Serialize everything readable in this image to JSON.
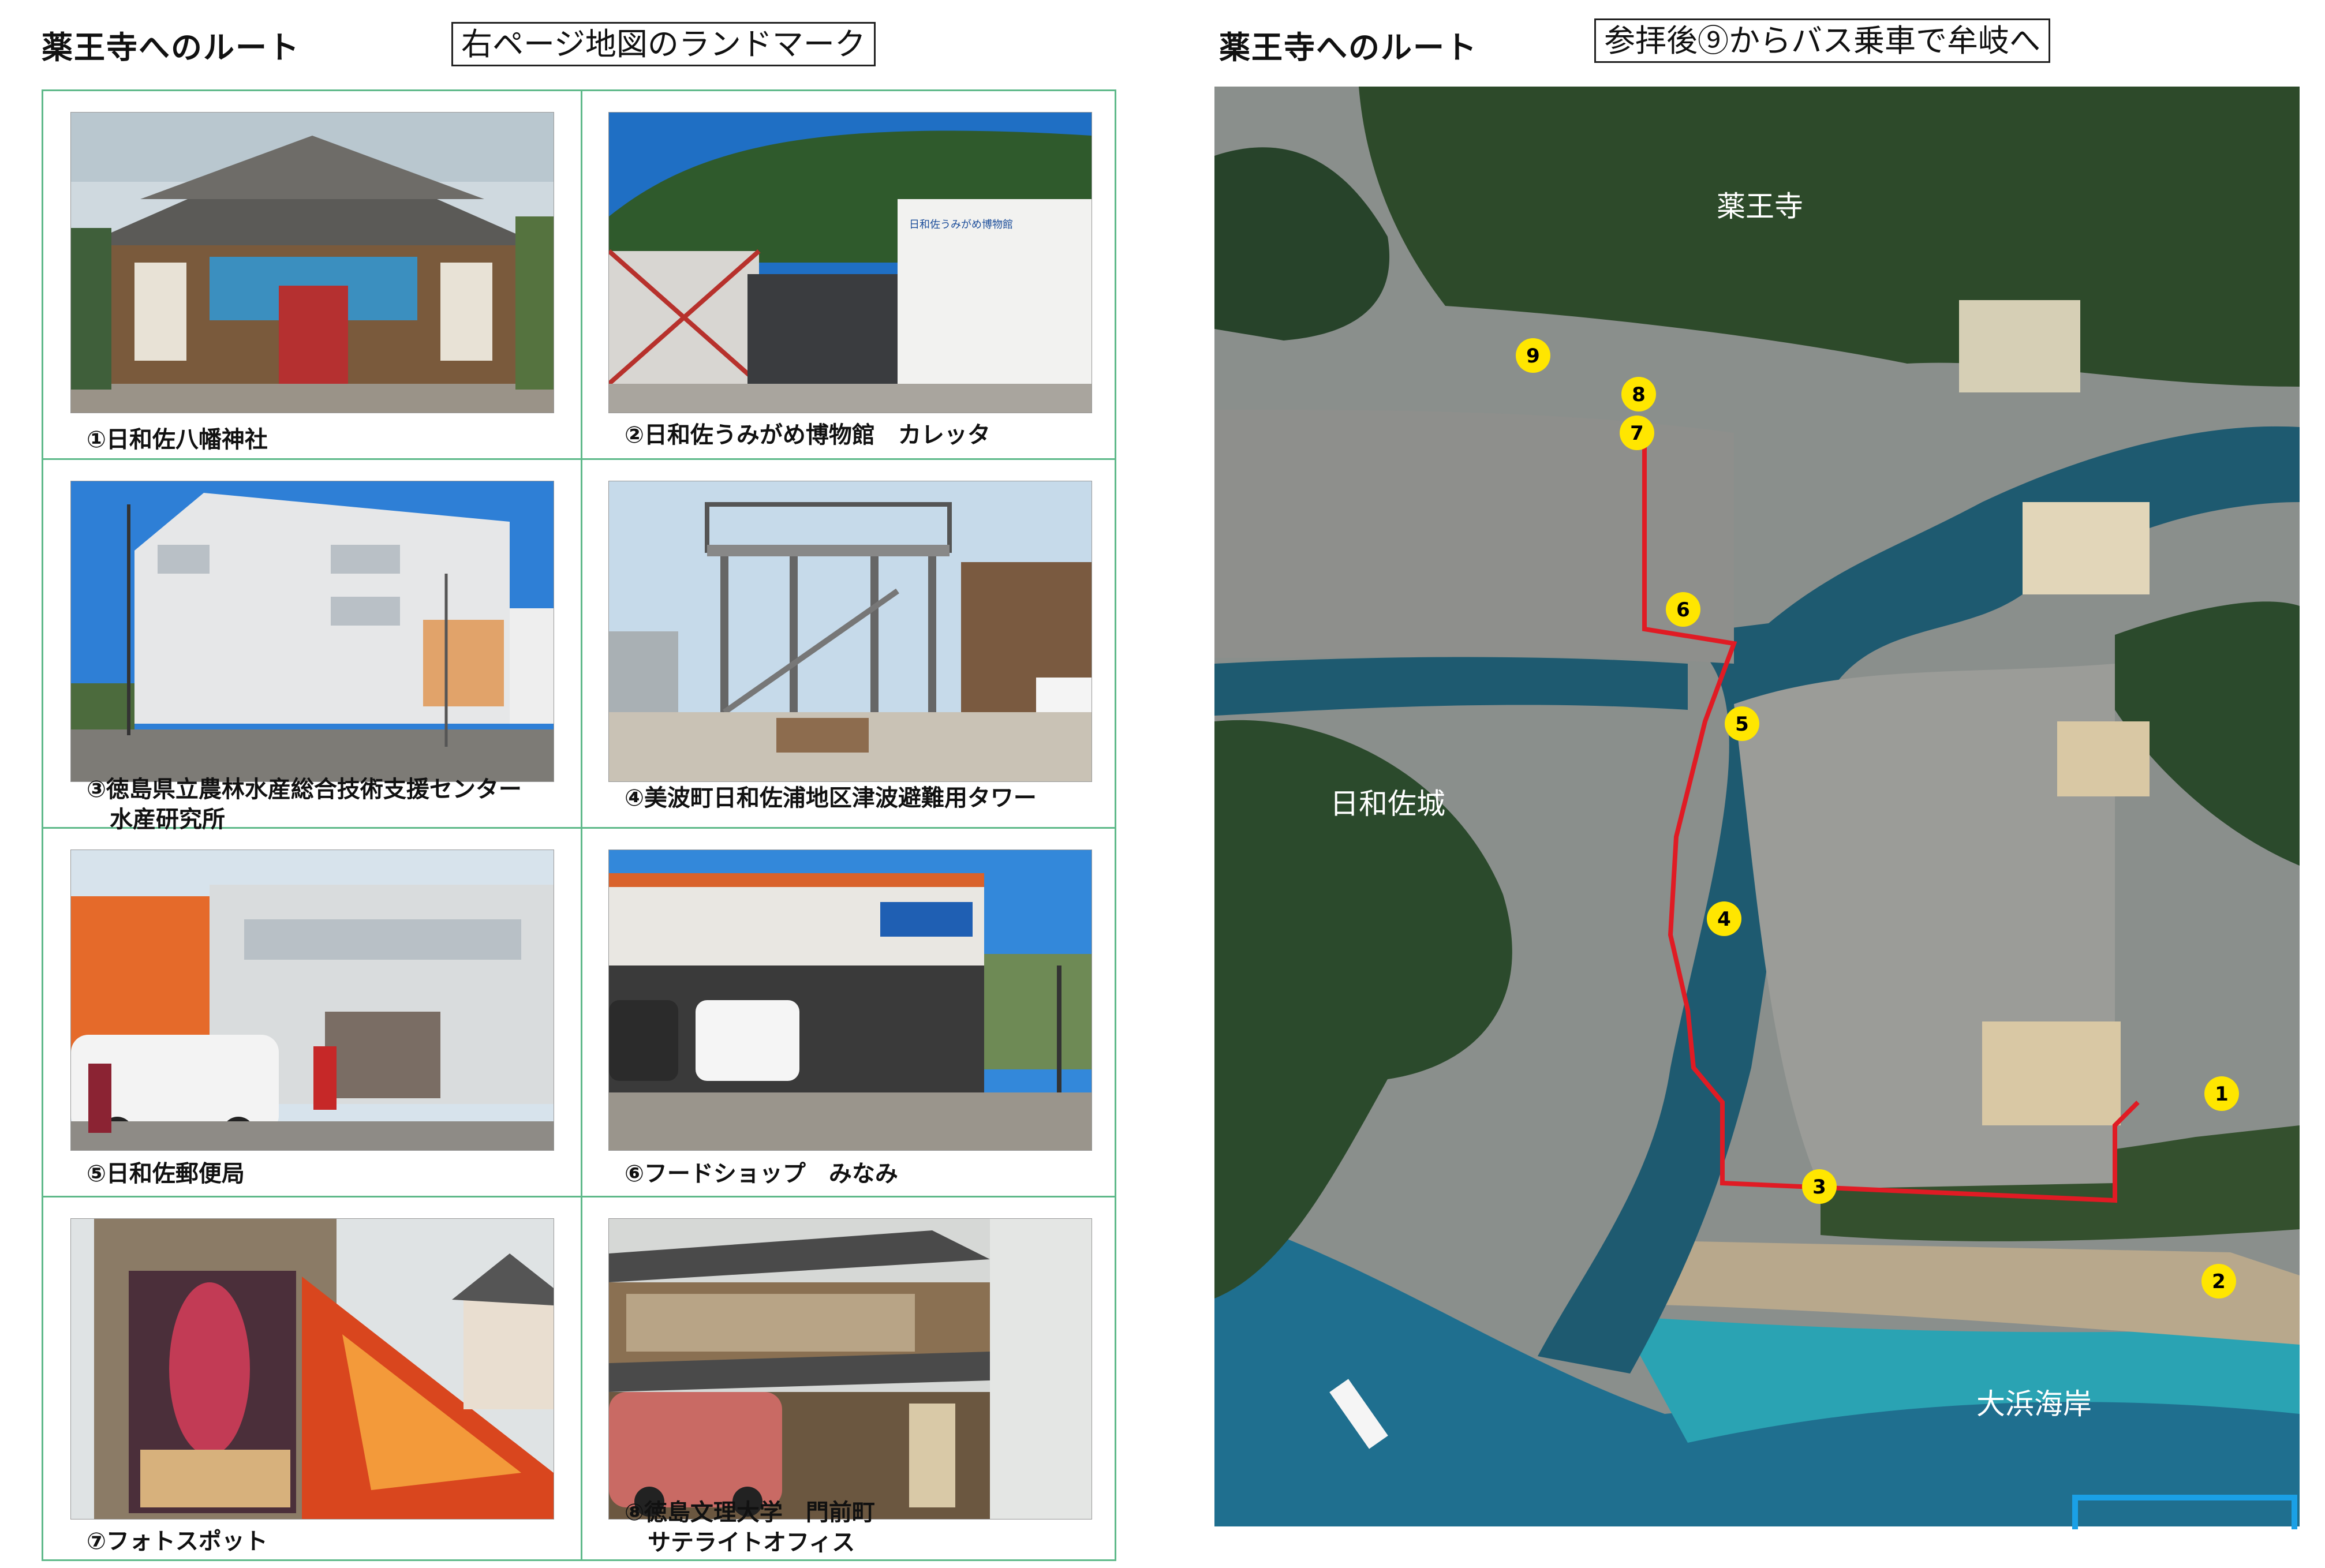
{
  "left_page": {
    "title": "薬王寺へのルート",
    "subtitle": "右ページ地図のランドマーク",
    "landmarks": [
      {
        "caption": "①日和佐八幡神社"
      },
      {
        "caption": "②日和佐うみがめ博物館　カレッタ"
      },
      {
        "caption": "③徳島県立農林水産総合技術支援センター\n　水産研究所"
      },
      {
        "caption": "④美波町日和佐浦地区津波避難用タワー"
      },
      {
        "caption": "⑤日和佐郵便局"
      },
      {
        "caption": "⑥フードショップ　みなみ"
      },
      {
        "caption": "⑦フォトスポット"
      },
      {
        "caption": "⑧徳島文理大学　門前町\n　サテライトオフィス"
      }
    ],
    "museum_sign": "日和佐うみがめ博物館"
  },
  "right_page": {
    "title": "薬王寺へのルート",
    "subtitle": "参拝後⑨からバス乗車で牟岐へ",
    "map": {
      "labels": {
        "temple": "薬王寺",
        "castle": "日和佐城",
        "beach": "大浜海岸"
      },
      "markers": [
        "1",
        "2",
        "3",
        "4",
        "5",
        "6",
        "7",
        "8",
        "9"
      ],
      "route_color": "#e01b24",
      "marker_color": "#ffe600"
    }
  }
}
